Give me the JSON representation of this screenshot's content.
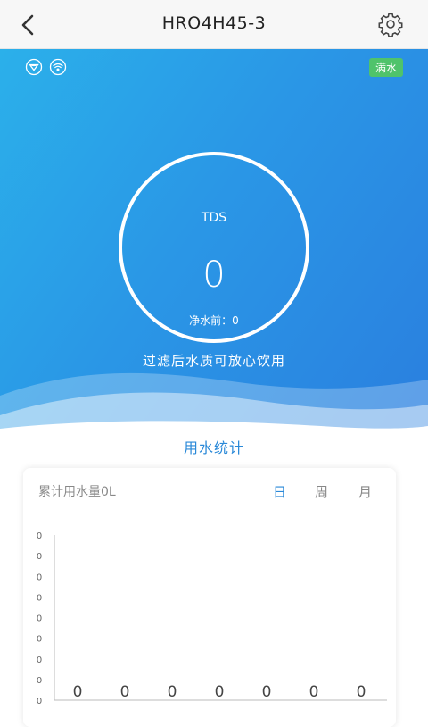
{
  "header": {
    "title": "HRO4H45-3"
  },
  "hero": {
    "status_badge": "满水",
    "tds_label": "TDS",
    "tds_value": "0",
    "tds_before": "净水前：0",
    "message": "过滤后水质可放心饮用"
  },
  "stats": {
    "section_title": "用水统计",
    "total_label": "累计用水量0L",
    "tabs": [
      "日",
      "周",
      "月"
    ],
    "active_tab": 0
  },
  "icons": {
    "back": "chevron-left-icon",
    "settings": "gear-icon",
    "filter": "filter-icon",
    "wifi": "wifi-icon"
  },
  "colors": {
    "accent": "#2a89d8",
    "badge": "#4fc36b",
    "hero_start": "#2bb0ea",
    "hero_end": "#2a7fdf"
  },
  "chart_data": {
    "type": "bar",
    "categories": [
      "",
      "",
      "",
      "",
      "",
      "",
      ""
    ],
    "values": [
      0,
      0,
      0,
      0,
      0,
      0,
      0
    ],
    "data_labels": [
      "0",
      "0",
      "0",
      "0",
      "0",
      "0",
      "0"
    ],
    "y_tick_labels": [
      "0",
      "0",
      "0",
      "0",
      "0",
      "0",
      "0",
      "0",
      "0"
    ],
    "grid": false
  }
}
